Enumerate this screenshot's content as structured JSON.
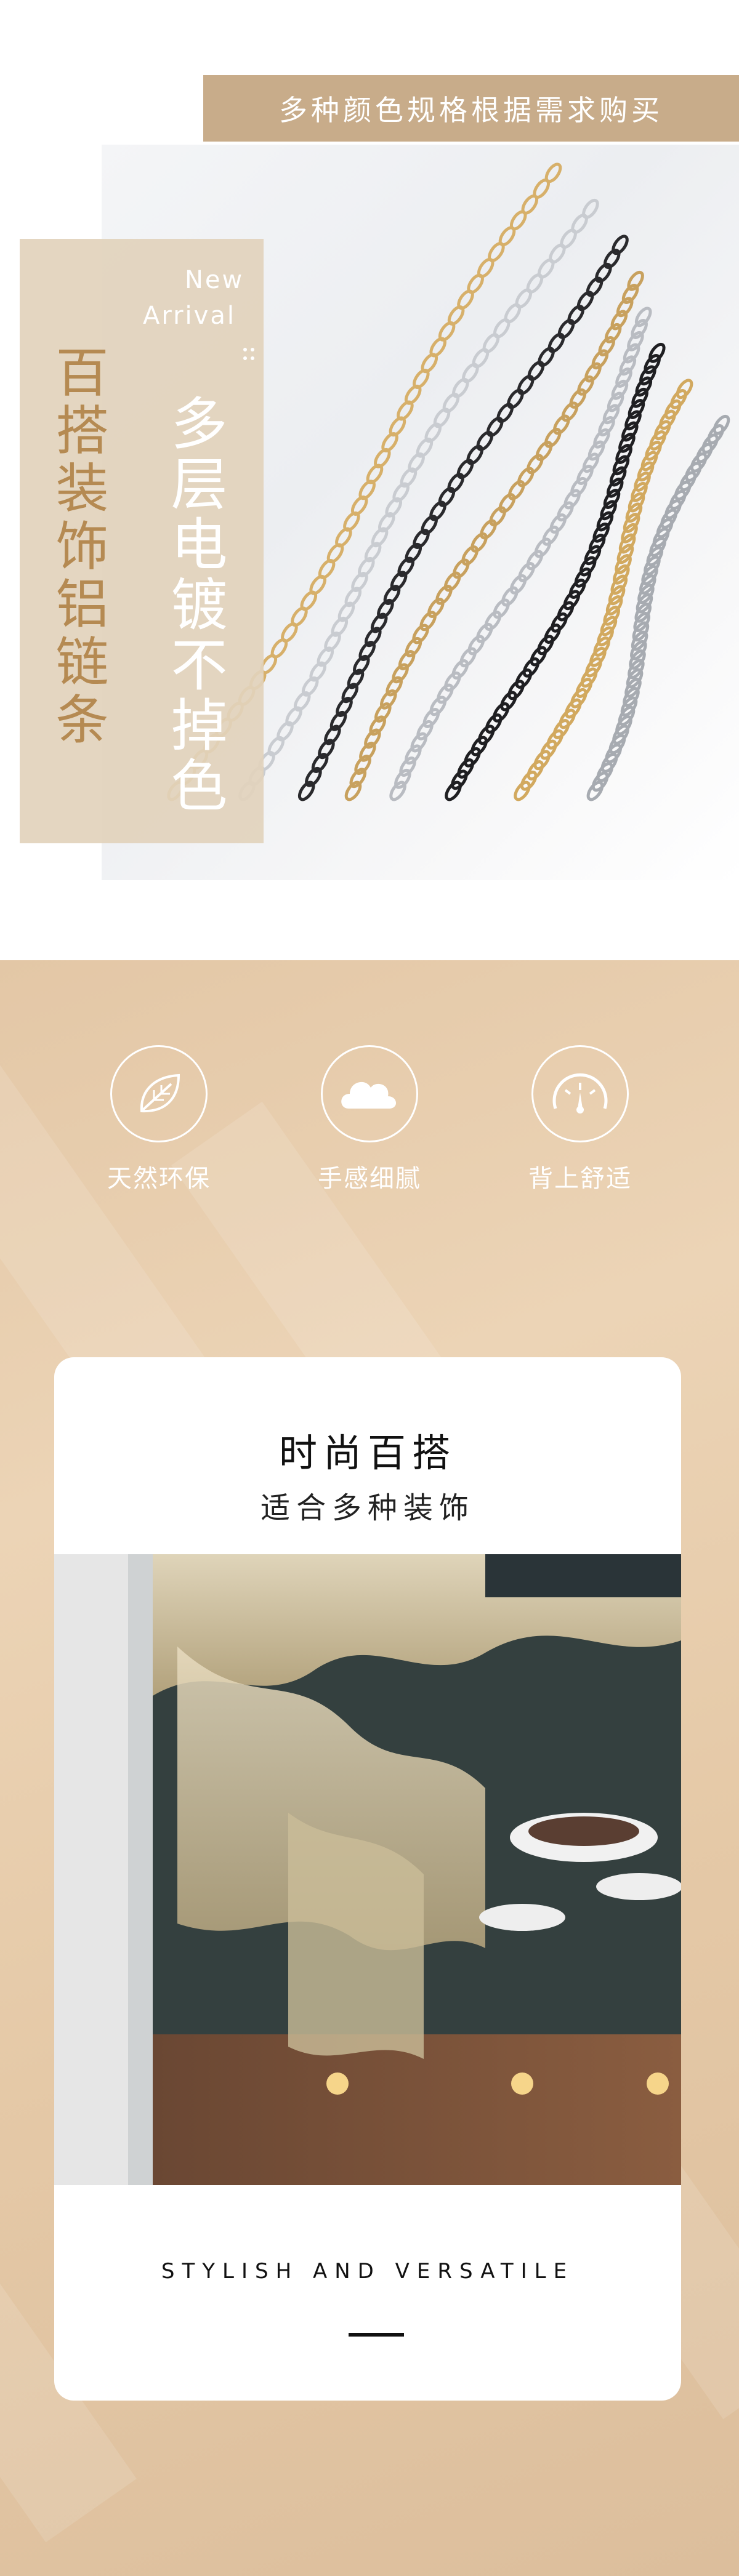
{
  "hero": {
    "banner_text": "多种颜色规格根据需求购买",
    "vertical_title": "百搭装饰铝链条",
    "vertical_subtitle": "多层电镀不掉色",
    "new_label": "New",
    "arrival_label": "Arrival",
    "chain_colors": [
      "#d7b06a",
      "#c9ccd1",
      "#2a2a2d",
      "#c8a15e",
      "#b9bcc2",
      "#1f1f22",
      "#d2a95f",
      "#a7abb1"
    ]
  },
  "features": {
    "items": [
      {
        "label": "天然环保",
        "icon": "leaf-icon"
      },
      {
        "label": "手感细腻",
        "icon": "cloud-icon"
      },
      {
        "label": "背上舒适",
        "icon": "gauge-icon"
      }
    ]
  },
  "card": {
    "title": "时尚百搭",
    "subtitle": "适合多种装饰",
    "footer": "STYLISH AND VERSATILE"
  },
  "colors": {
    "accent": "#c8ac8a",
    "title_gold": "#b58a52",
    "background_beige": "#e5c9a7"
  }
}
